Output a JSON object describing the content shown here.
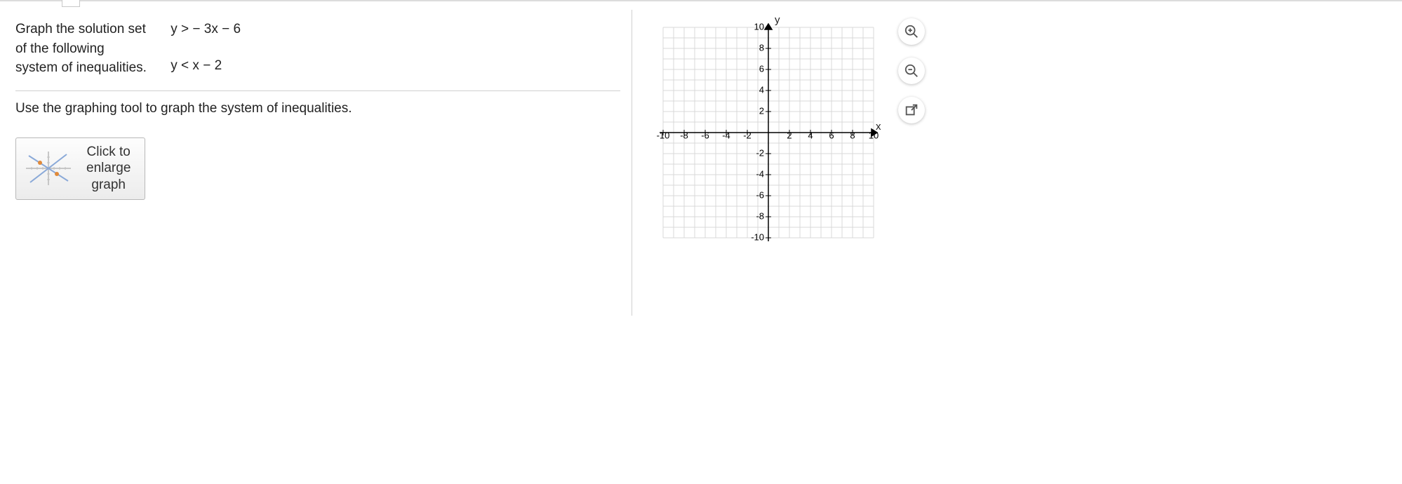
{
  "question": {
    "prompt_line1": "Graph the solution set",
    "prompt_line2": "of the following",
    "prompt_line3": "system of inequalities.",
    "ineq1": "y  >   − 3x − 6",
    "ineq2": "y  <   x − 2"
  },
  "instruction": "Use the graphing tool to graph the system of inequalities.",
  "enlarge": {
    "line1": "Click to",
    "line2": "enlarge",
    "line3": "graph"
  },
  "chart_data": {
    "type": "scatter",
    "title": "",
    "xlabel": "x",
    "ylabel": "y",
    "xlim": [
      -10,
      10
    ],
    "ylim": [
      -10,
      10
    ],
    "x_ticks": [
      -10,
      -8,
      -6,
      -4,
      -2,
      2,
      4,
      6,
      8,
      10
    ],
    "y_ticks": [
      -10,
      -8,
      -6,
      -4,
      -2,
      2,
      4,
      6,
      8,
      10
    ],
    "grid": true,
    "series": []
  },
  "tools": {
    "zoom_in": "zoom-in",
    "zoom_out": "zoom-out",
    "popout": "popout"
  }
}
